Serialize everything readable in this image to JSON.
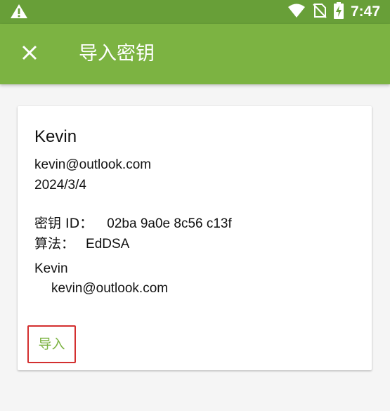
{
  "colors": {
    "primary": "#7cb342",
    "primary_dark": "#689f38",
    "highlight_border": "#d32f2f"
  },
  "status_bar": {
    "time": "7:47",
    "icons": [
      "warning-icon",
      "wifi-icon",
      "no-sim-icon",
      "battery-charging-icon"
    ]
  },
  "app_bar": {
    "close_icon": "close-icon",
    "title": "导入密钥"
  },
  "key": {
    "name": "Kevin",
    "email": "kevin@outlook.com",
    "date": "2024/3/4",
    "key_id_label": "密钥 ID：",
    "key_id": "02ba 9a0e 8c56 c13f",
    "algorithm_label": "算法：",
    "algorithm": "EdDSA",
    "user_id_name": "Kevin",
    "user_id_email": "kevin@outlook.com"
  },
  "actions": {
    "import_label": "导入"
  }
}
